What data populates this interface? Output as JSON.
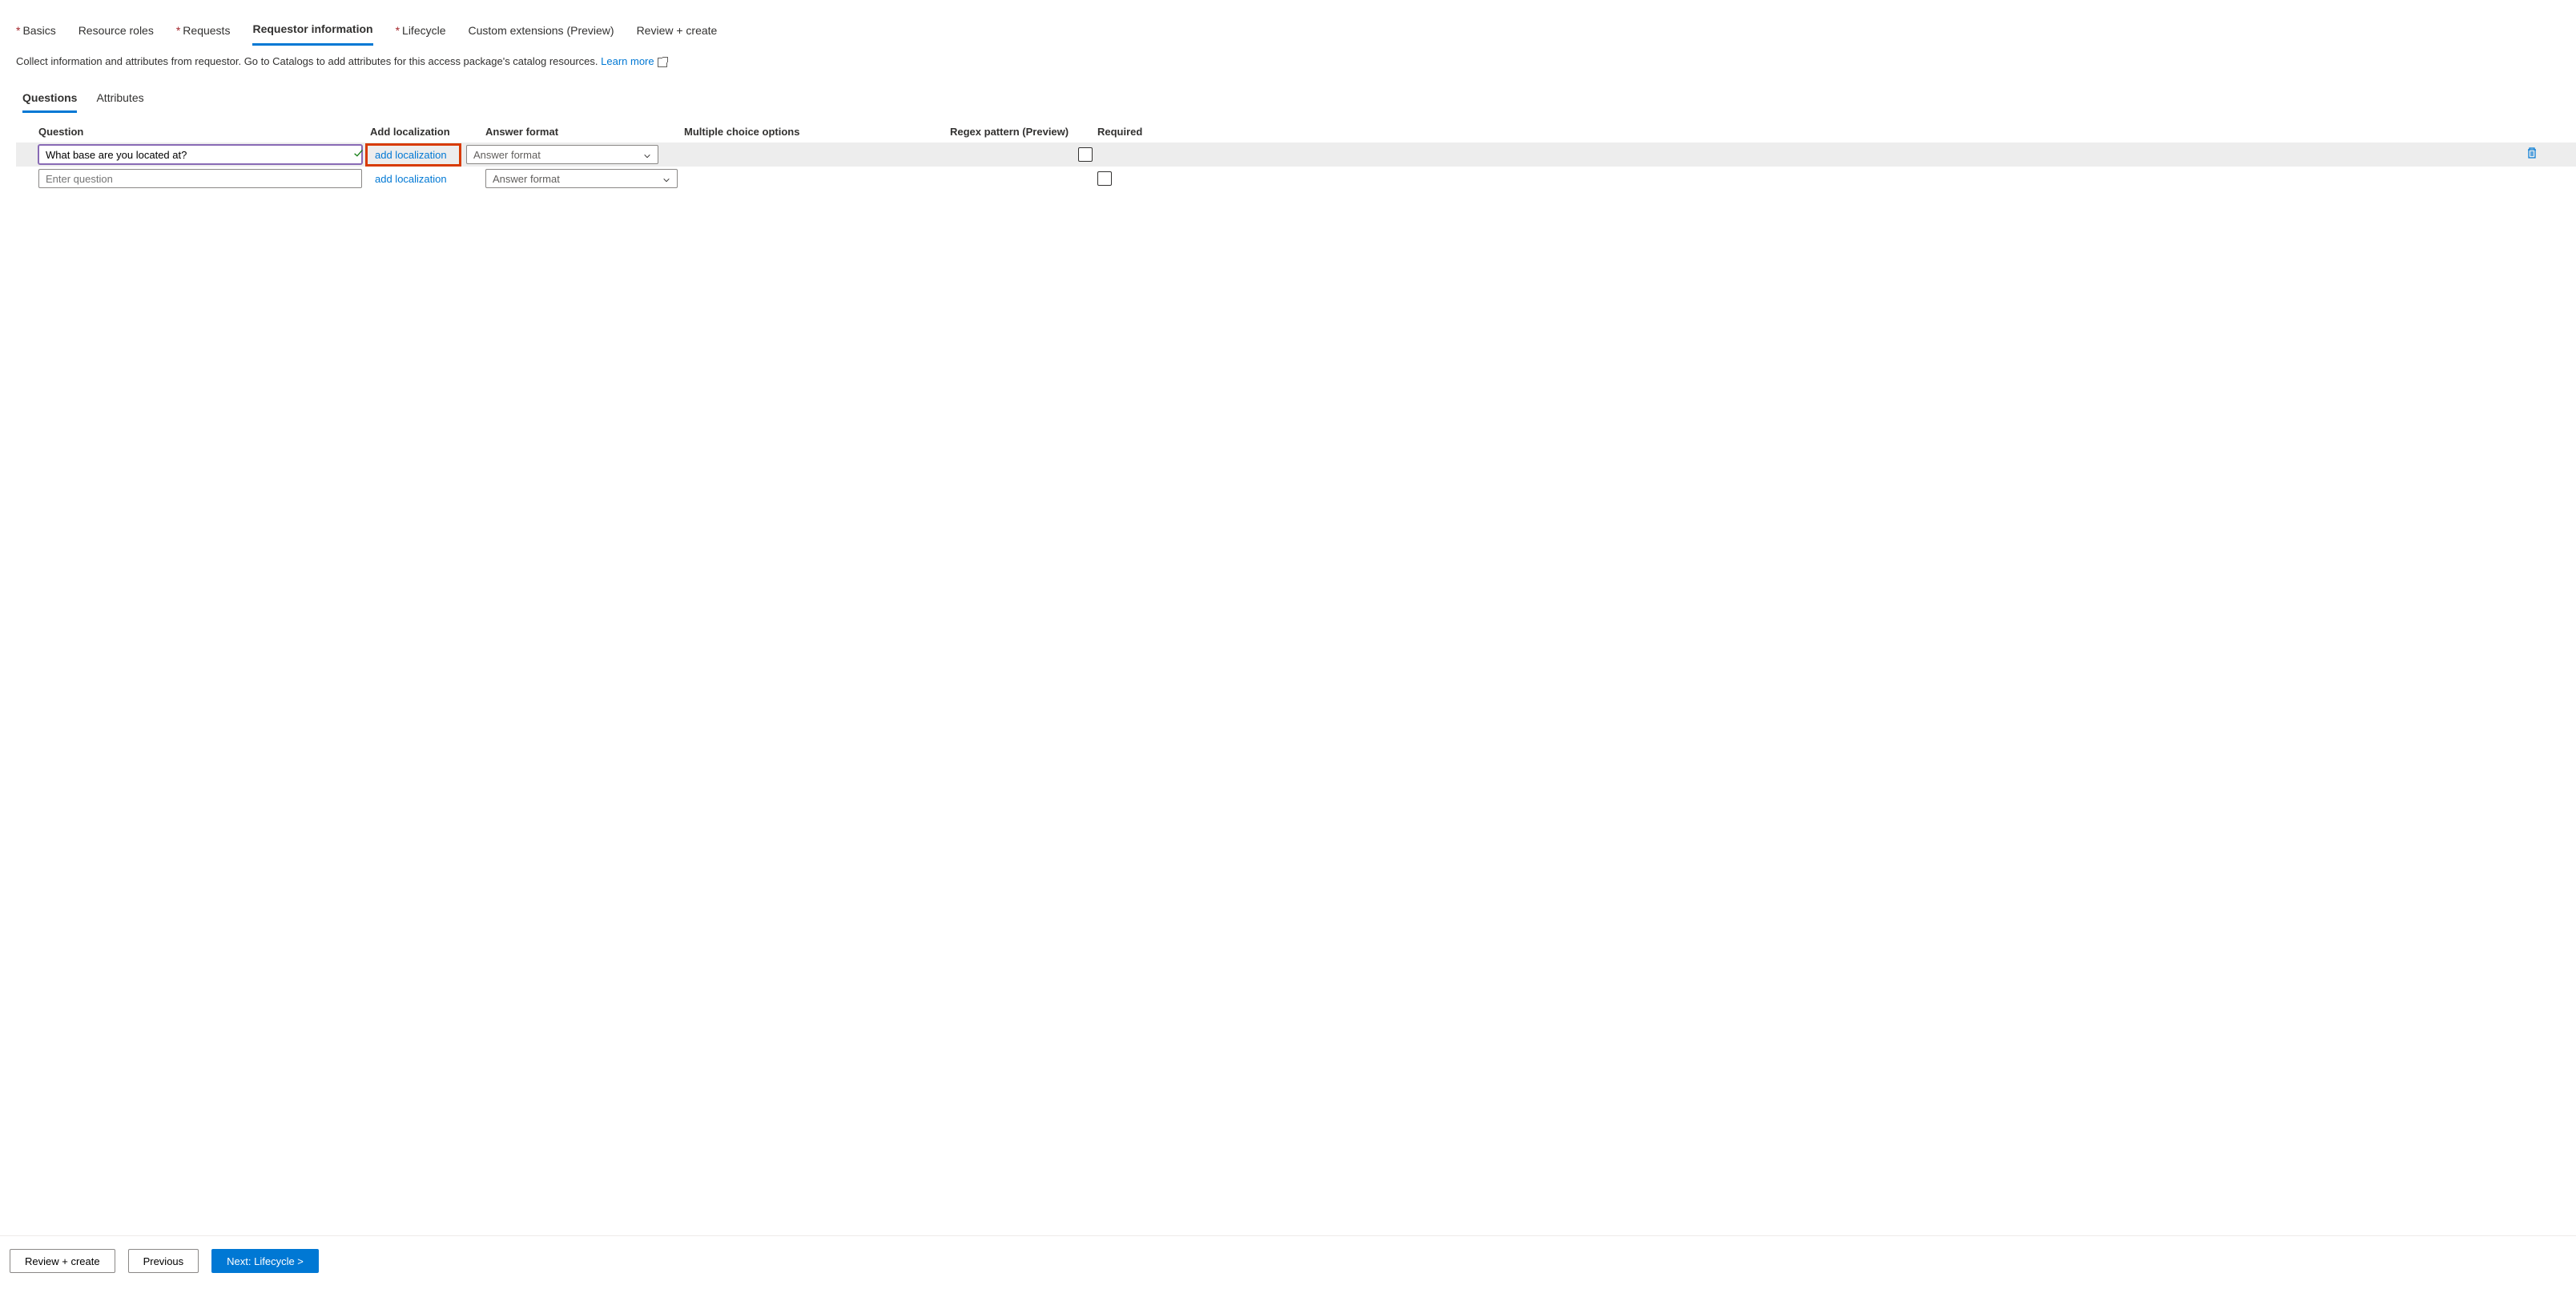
{
  "mainTabs": {
    "basics": "Basics",
    "resourceRoles": "Resource roles",
    "requests": "Requests",
    "requestorInfo": "Requestor information",
    "lifecycle": "Lifecycle",
    "customExt": "Custom extensions (Preview)",
    "reviewCreate": "Review + create"
  },
  "description": {
    "text": "Collect information and attributes from requestor. Go to Catalogs to add attributes for this access package's catalog resources. ",
    "link": "Learn more"
  },
  "subTabs": {
    "questions": "Questions",
    "attributes": "Attributes"
  },
  "columns": {
    "question": "Question",
    "addLocalization": "Add localization",
    "answerFormat": "Answer format",
    "multipleChoice": "Multiple choice options",
    "regex": "Regex pattern (Preview)",
    "required": "Required"
  },
  "rows": {
    "r1": {
      "question": "What base are you located at?",
      "localization": "add localization",
      "answerFormat": "Answer format"
    },
    "r2": {
      "question": "",
      "placeholder": "Enter question",
      "localization": "add localization",
      "answerFormat": "Answer format"
    }
  },
  "buttons": {
    "reviewCreate": "Review + create",
    "previous": "Previous",
    "next": "Next: Lifecycle >"
  }
}
